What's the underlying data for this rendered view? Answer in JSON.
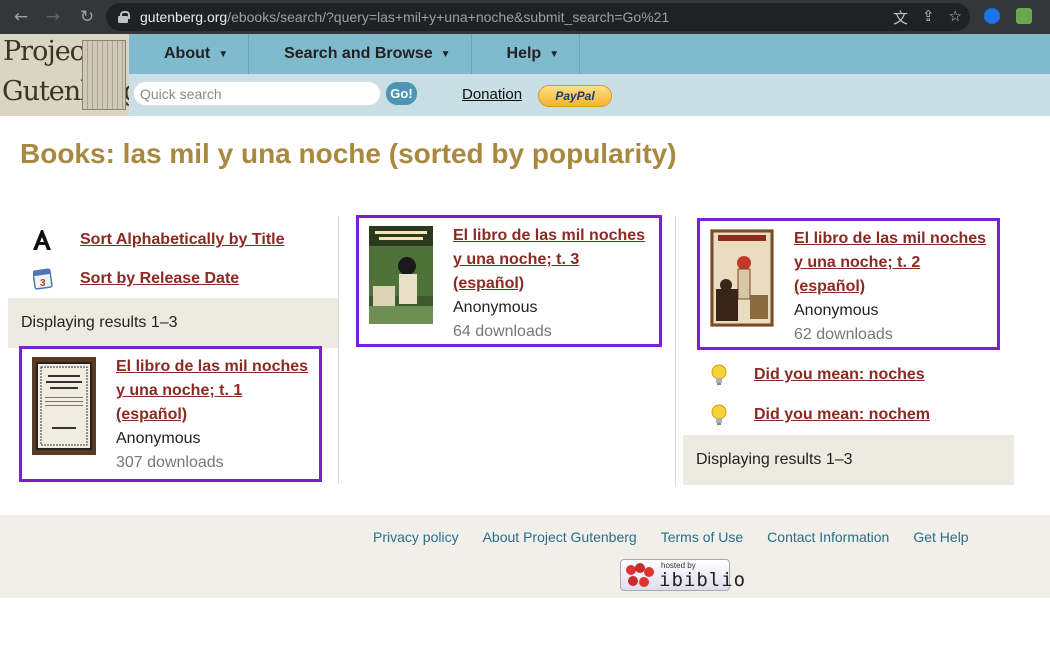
{
  "browser": {
    "url_host": "gutenberg.org",
    "url_path": "/ebooks/search/?query=las+mil+y+una+noche&submit_search=Go%21"
  },
  "logo": {
    "line1": "Project",
    "line2": "Gutenberg"
  },
  "nav": {
    "about": "About",
    "search_browse": "Search and Browse",
    "help": "Help"
  },
  "search": {
    "placeholder": "Quick search",
    "go_label": "Go!"
  },
  "donation": {
    "label": "Donation",
    "paypal": "PayPal"
  },
  "page_title": "Books: las mil y una noche (sorted by popularity)",
  "sort": {
    "alpha": "Sort Alphabetically by Title",
    "release": "Sort by Release Date",
    "calendar_day": "3"
  },
  "results_label": "Displaying results 1–3",
  "books": [
    {
      "title_lines": [
        "El libro de las mil noches",
        "y una noche; t. 1",
        "(español)"
      ],
      "author": "Anonymous",
      "downloads": "307 downloads",
      "cover_text": "EL LIBRO DE LAS MIL NOCHES Y UNA NOCHE"
    },
    {
      "title_lines": [
        "El libro de las mil noches",
        "y una noche; t. 3",
        "(español)"
      ],
      "author": "Anonymous",
      "downloads": "64 downloads",
      "cover_text": "EL LIBRO DE LAS MIL NOCHES Y UNA NOCHE"
    },
    {
      "title_lines": [
        "El libro de las mil noches",
        "y una noche; t. 2",
        "(español)"
      ],
      "author": "Anonymous",
      "downloads": "62 downloads"
    }
  ],
  "did_you_mean": [
    "Did you mean: noches",
    "Did you mean: nochem"
  ],
  "footer": {
    "links": [
      "Privacy policy",
      "About Project Gutenberg",
      "Terms of Use",
      "Contact Information",
      "Get Help"
    ],
    "ibiblio_hosted": "hosted by",
    "ibiblio_name": "ibiblio"
  },
  "colors": {
    "title": "#a8893f",
    "link": "#8b2a22",
    "highlight": "#7b1fd6",
    "nav": "#7fbacd"
  }
}
